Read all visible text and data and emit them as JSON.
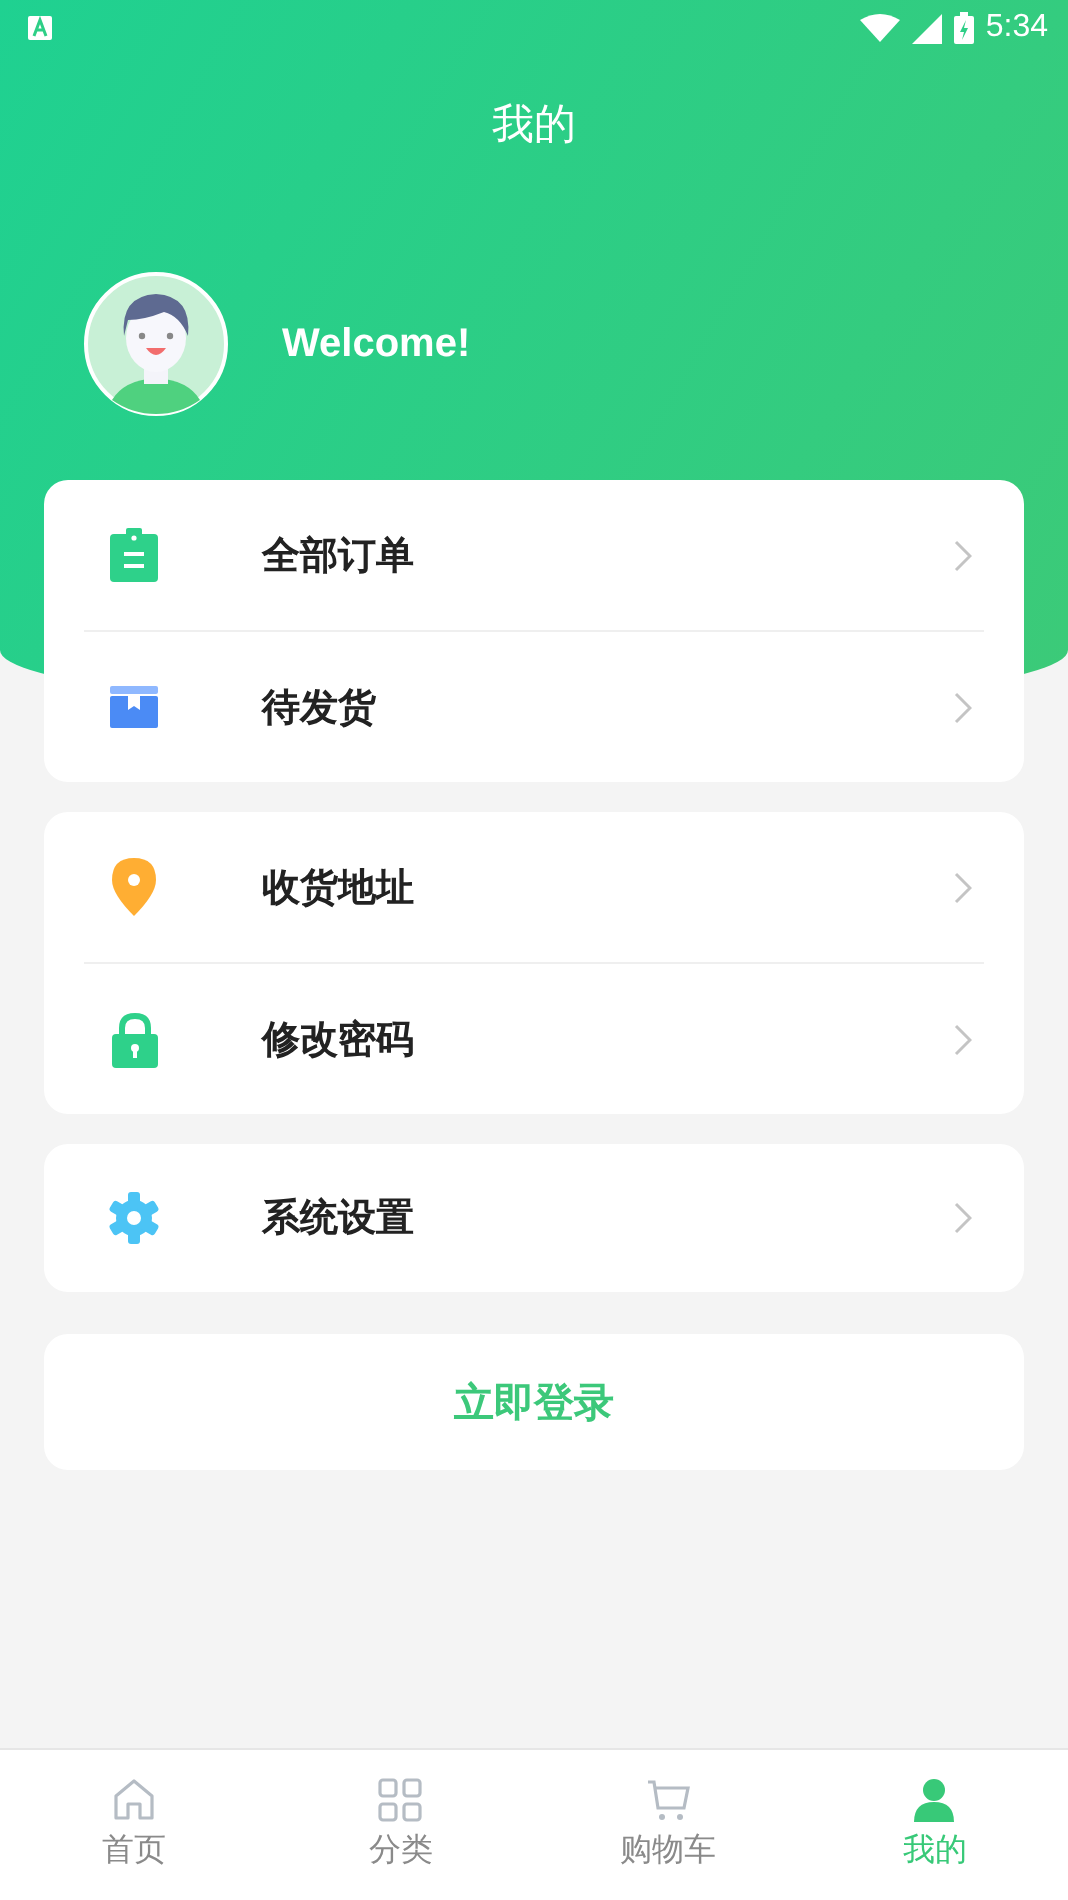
{
  "status_bar": {
    "time": "5:34"
  },
  "header": {
    "title": "我的",
    "greeting": "Welcome!"
  },
  "menu_groups": [
    {
      "items": [
        {
          "kind": "orders",
          "label": "全部订单"
        },
        {
          "kind": "shipping",
          "label": "待发货"
        }
      ]
    },
    {
      "items": [
        {
          "kind": "address",
          "label": "收货地址"
        },
        {
          "kind": "password",
          "label": "修改密码"
        }
      ]
    },
    {
      "items": [
        {
          "kind": "settings",
          "label": "系统设置"
        }
      ]
    }
  ],
  "login_button": "立即登录",
  "tab_bar": [
    {
      "kind": "home",
      "label": "首页",
      "selected": false
    },
    {
      "kind": "category",
      "label": "分类",
      "selected": false
    },
    {
      "kind": "cart",
      "label": "购物车",
      "selected": false
    },
    {
      "kind": "profile",
      "label": "我的",
      "selected": true
    }
  ]
}
